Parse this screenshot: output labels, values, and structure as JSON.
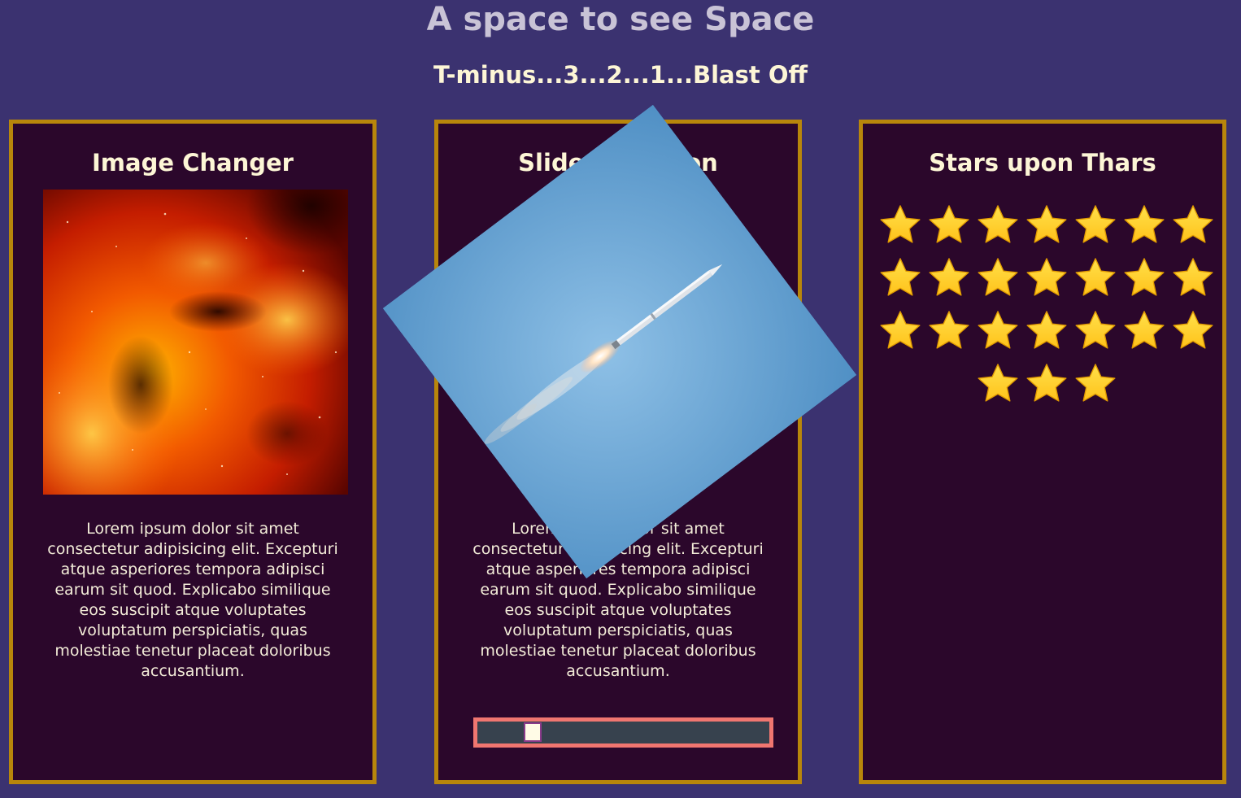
{
  "header": {
    "title": "A space to see Space",
    "subtitle": "T-minus...3...2...1...Blast Off"
  },
  "cards": [
    {
      "title": "Image Changer",
      "image": "nebula-image",
      "text": "Lorem ipsum dolor sit amet consectetur adipisicing elit. Excepturi atque asperiores tempora adipisci earum sit quod. Explicabo similique eos suscipit atque voluptates voluptatum perspiciatis, quas molestiae tenetur placeat doloribus accusantium."
    },
    {
      "title": "Slider Rotation",
      "image": "rocket-launch-image",
      "text": "Lorem ipsum dolor sit amet consectetur adipisicing elit. Excepturi atque asperiores tempora adipisci earum sit quod. Explicabo similique eos suscipit atque voluptates voluptatum perspiciatis, quas molestiae tenetur placeat doloribus accusantium.",
      "slider": {
        "value_fraction": 0.17,
        "rotation_deg": -37
      }
    },
    {
      "title": "Stars upon Thars",
      "star_count": 24,
      "star_icon": "star-icon"
    }
  ],
  "colors": {
    "background": "#3b3270",
    "card": "#2b072b",
    "card_border": "#b8860b",
    "slider_border": "#f07670",
    "slider_track": "#37424e",
    "star": "#ffc21a"
  }
}
